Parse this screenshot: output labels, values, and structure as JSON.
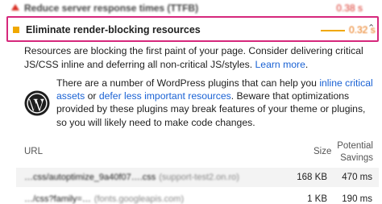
{
  "previous_audit": {
    "title": "Reduce server response times (TTFB)",
    "savings": "0.38 s",
    "status_color": "#d93025"
  },
  "audit": {
    "title": "Eliminate render-blocking resources",
    "savings": "0.32 s",
    "status_color": "#f0a800",
    "highlight_color": "#d6287c",
    "expanded": true
  },
  "description": {
    "text": "Resources are blocking the first paint of your page. Consider delivering critical JS/CSS inline and deferring all non-critical JS/styles. ",
    "link": "Learn more",
    "end": "."
  },
  "stack_pack": {
    "icon": "wordpress-logo",
    "part1": "There are a number of WordPress plugins that can help you ",
    "link1": "inline critical assets",
    "part2": " or ",
    "link2": "defer less important resources",
    "part3": ". Beware that optimizations provided by these plugins may break features of your theme or plugins, so you will likely need to make code changes."
  },
  "table": {
    "headers": {
      "url": "URL",
      "size": "Size",
      "savings_line1": "Potential",
      "savings_line2": "Savings"
    },
    "rows": [
      {
        "url": "…css/autoptimize_9a40f07….css",
        "host": "(support-test2.on.ro)",
        "size": "168 KB",
        "savings": "470 ms"
      },
      {
        "url": "…/css?family=…",
        "host": "(fonts.googleapis.com)",
        "size": "1 KB",
        "savings": "190 ms"
      }
    ]
  }
}
